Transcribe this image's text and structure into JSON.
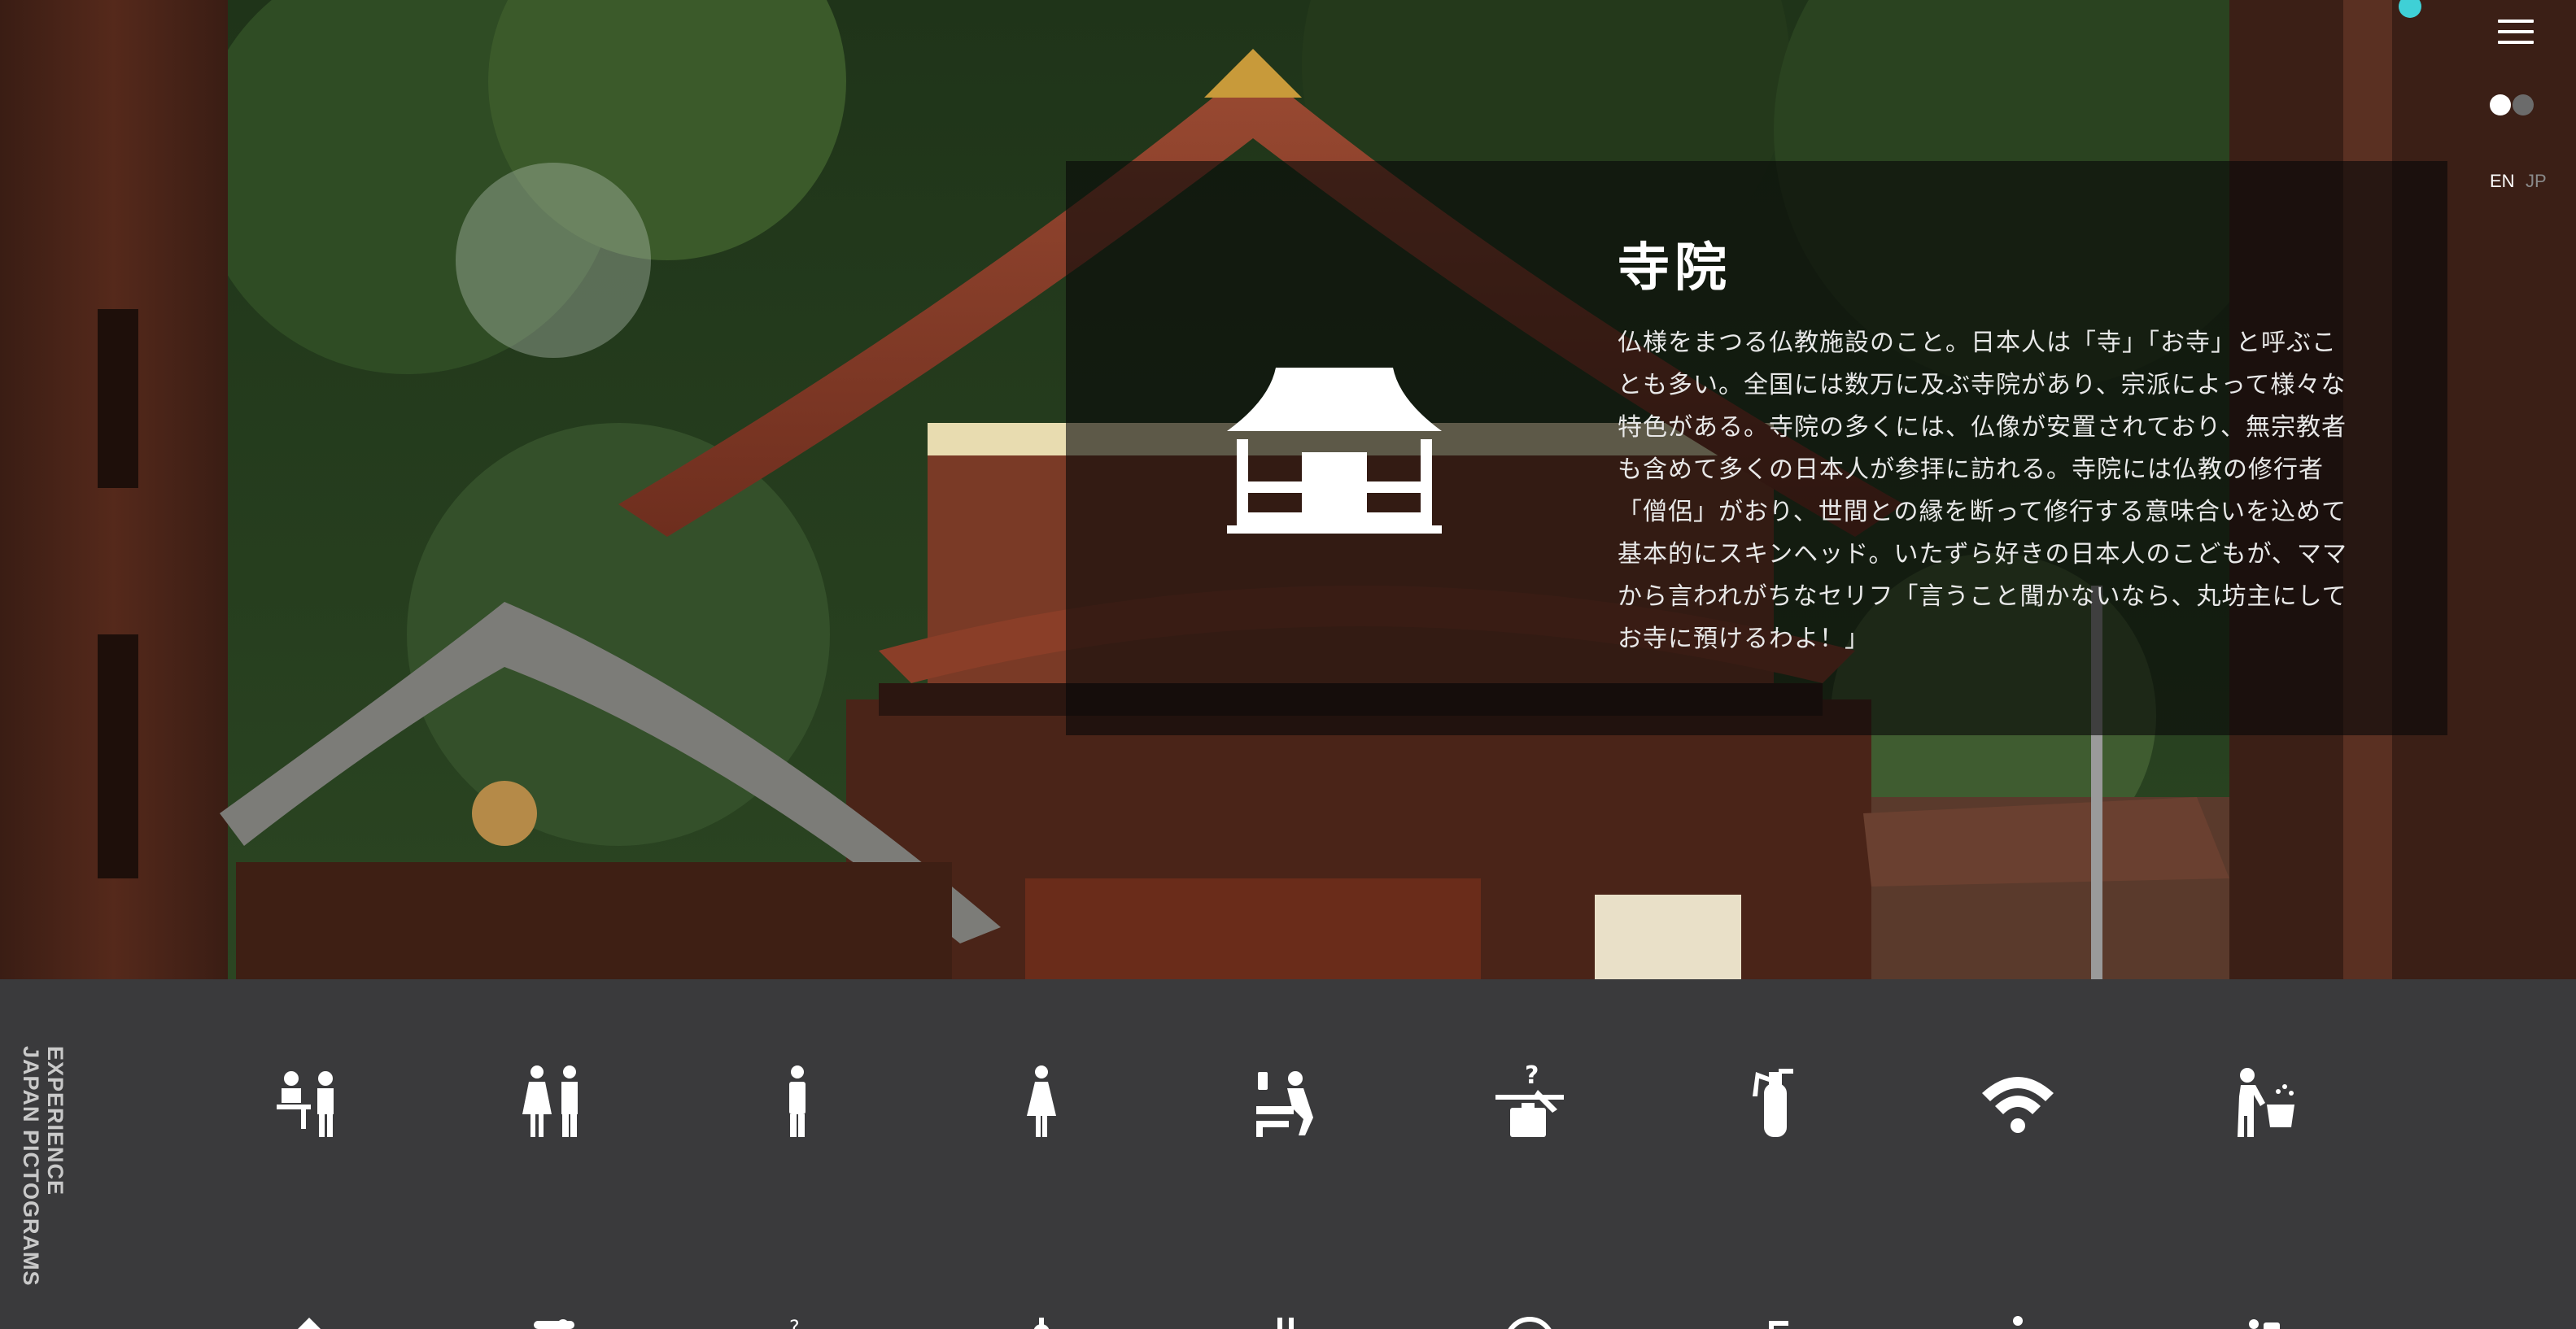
{
  "hero": {
    "title": "寺院",
    "description": "仏様をまつる仏教施設のこと。日本人は「寺」「お寺」と呼ぶことも多い。全国には数万に及ぶ寺院があり、宗派によって様々な特色がある。寺院の多くには、仏像が安置されており、無宗教者も含めて多くの日本人が参拝に訪れる。寺院には仏教の修行者「僧侶」がおり、世間との縁を断って修行する意味合いを込めて基本的にスキンヘッド。いたずら好きの日本人のこどもが、ママから言われがちなセリフ「言うこと聞かないなら、丸坊主にしてお寺に預けるわよ！」",
    "icon": "temple-icon"
  },
  "controls": {
    "menu_icon": "hamburger-menu-icon",
    "theme": "light",
    "lang_en": "EN",
    "lang_jp": "JP",
    "active_lang": "EN",
    "accent_color": "#3fd0d6"
  },
  "brand": {
    "line1": "EXPERIENCE",
    "line2": "JAPAN PICTOGRAMS"
  },
  "pictograms": [
    {
      "icon": "reception-desk-icon"
    },
    {
      "icon": "restrooms-icon"
    },
    {
      "icon": "mens-restroom-icon"
    },
    {
      "icon": "womens-restroom-icon"
    },
    {
      "icon": "baby-changing-icon"
    },
    {
      "icon": "lost-and-found-icon"
    },
    {
      "icon": "fire-extinguisher-icon"
    },
    {
      "icon": "wifi-icon"
    },
    {
      "icon": "hand-washing-icon"
    }
  ],
  "colors": {
    "panel_bg": "rgba(8,8,8,0.62)",
    "gallery_bg": "#3a3a3c"
  }
}
